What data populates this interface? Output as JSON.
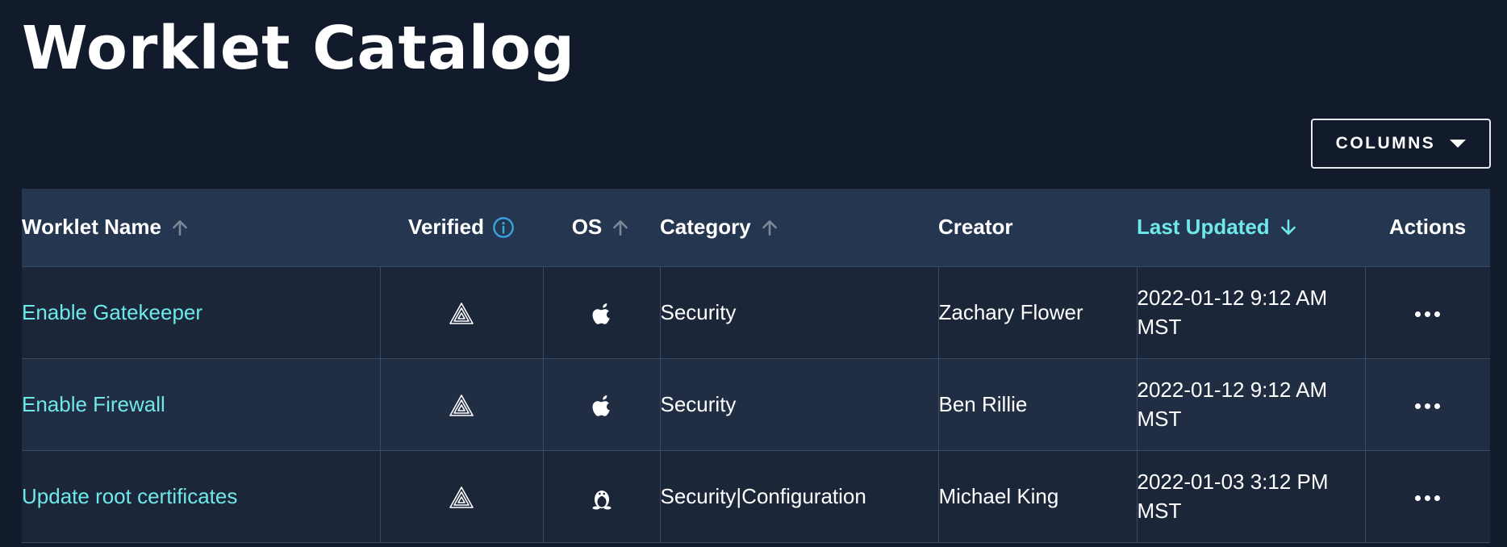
{
  "page": {
    "title": "Worklet Catalog"
  },
  "toolbar": {
    "columns_label": "COLUMNS"
  },
  "table": {
    "headers": {
      "name": "Worklet Name",
      "verified": "Verified",
      "os": "OS",
      "category": "Category",
      "creator": "Creator",
      "last_updated": "Last Updated",
      "actions": "Actions"
    },
    "sort": {
      "active_column": "last_updated",
      "direction": "descending",
      "active_color": "#6fe8ea"
    },
    "rows": [
      {
        "name": "Enable Gatekeeper",
        "verified_icon": "verified-badge-icon",
        "os_icon": "apple-icon",
        "category": "Security",
        "creator": "Zachary Flower",
        "last_updated": "2022-01-12 9:12 AM MST",
        "actions_icon": "more-icon"
      },
      {
        "name": "Enable Firewall",
        "verified_icon": "verified-badge-icon",
        "os_icon": "apple-icon",
        "category": "Security",
        "creator": "Ben Rillie",
        "last_updated": "2022-01-12 9:12 AM MST",
        "actions_icon": "more-icon"
      },
      {
        "name": "Update root certificates",
        "verified_icon": "verified-badge-icon",
        "os_icon": "linux-icon",
        "category": "Security|Configuration",
        "creator": "Michael King",
        "last_updated": "2022-01-03 3:12 PM MST",
        "actions_icon": "more-icon"
      }
    ]
  },
  "colors": {
    "background": "#121b2b",
    "header_row": "#253650",
    "link": "#6fe8ea"
  }
}
